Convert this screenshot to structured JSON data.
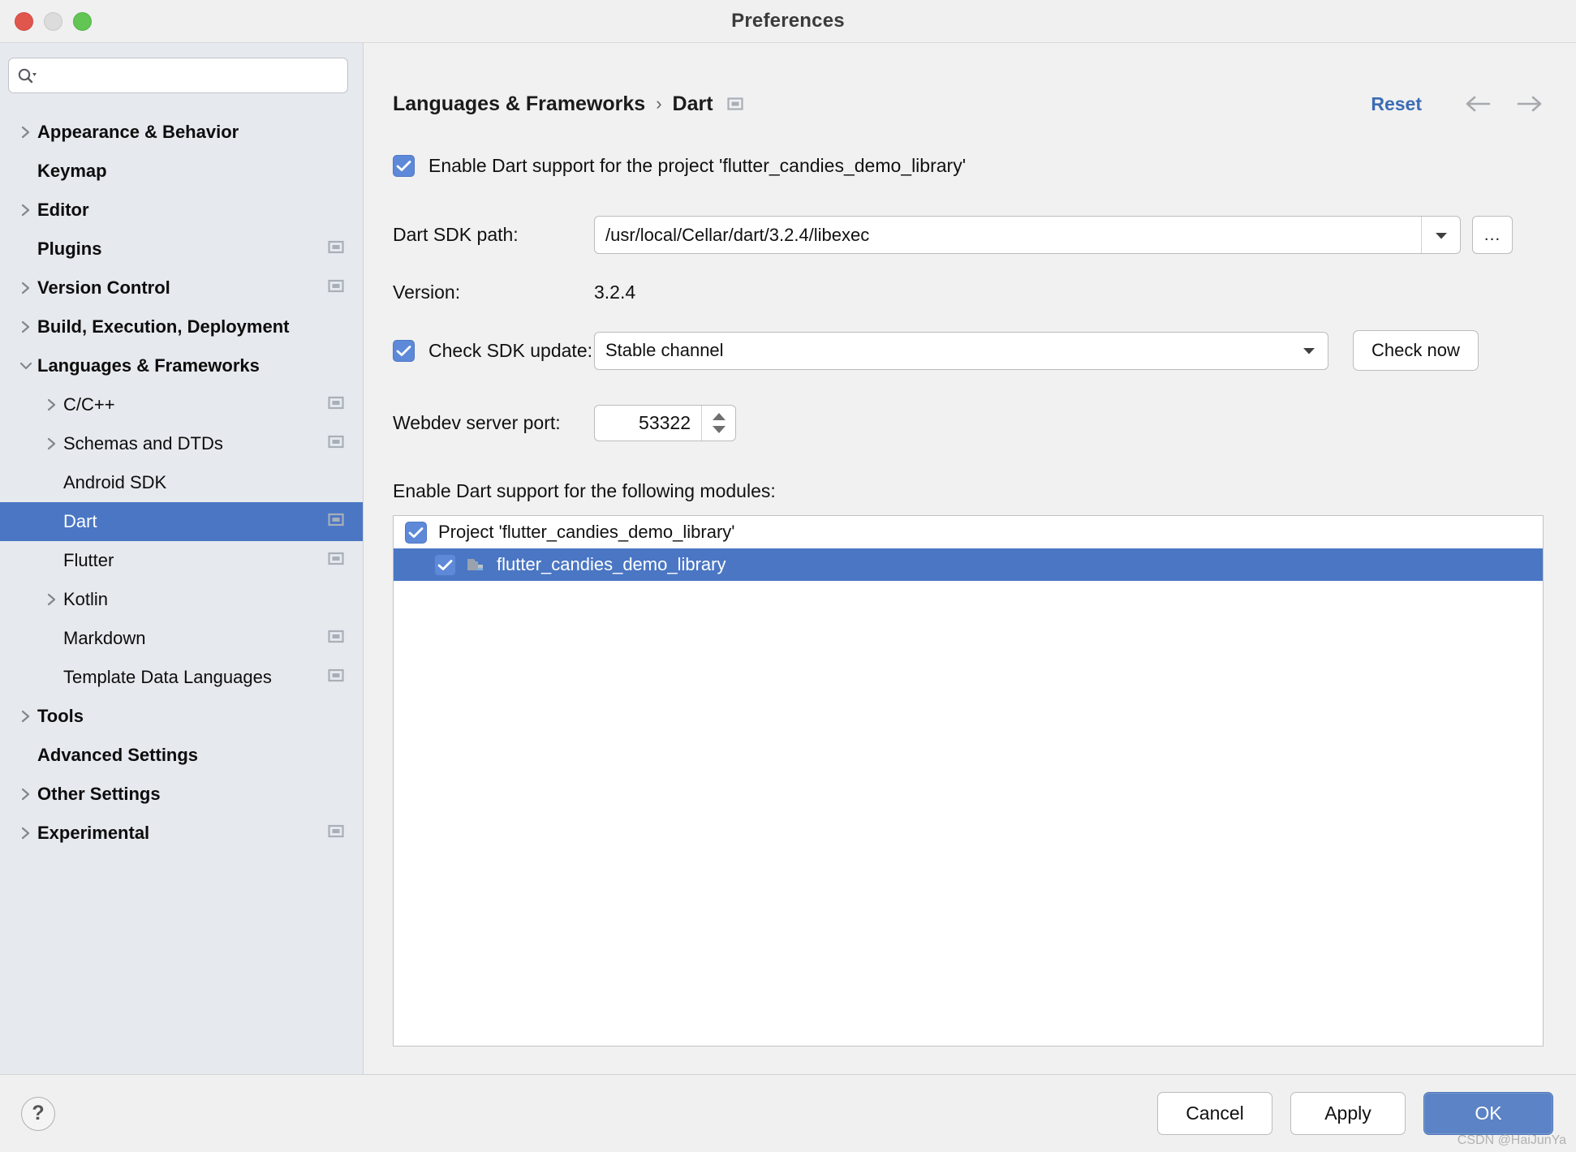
{
  "window": {
    "title": "Preferences",
    "traffic_lights": [
      "close",
      "minimize",
      "maximize"
    ]
  },
  "sidebar": {
    "search": {
      "value": "",
      "placeholder": ""
    },
    "items": [
      {
        "label": "Appearance & Behavior",
        "level": 0,
        "arrow": "right",
        "badge": false,
        "selected": false
      },
      {
        "label": "Keymap",
        "level": 0,
        "arrow": "none",
        "badge": false,
        "selected": false
      },
      {
        "label": "Editor",
        "level": 0,
        "arrow": "right",
        "badge": false,
        "selected": false
      },
      {
        "label": "Plugins",
        "level": 0,
        "arrow": "none",
        "badge": true,
        "selected": false
      },
      {
        "label": "Version Control",
        "level": 0,
        "arrow": "right",
        "badge": true,
        "selected": false
      },
      {
        "label": "Build, Execution, Deployment",
        "level": 0,
        "arrow": "right",
        "badge": false,
        "selected": false
      },
      {
        "label": "Languages & Frameworks",
        "level": 0,
        "arrow": "down",
        "badge": false,
        "selected": false
      },
      {
        "label": "C/C++",
        "level": 1,
        "arrow": "right",
        "badge": true,
        "selected": false
      },
      {
        "label": "Schemas and DTDs",
        "level": 1,
        "arrow": "right",
        "badge": true,
        "selected": false
      },
      {
        "label": "Android SDK",
        "level": 1,
        "arrow": "none",
        "badge": false,
        "selected": false
      },
      {
        "label": "Dart",
        "level": 1,
        "arrow": "none",
        "badge": true,
        "selected": true
      },
      {
        "label": "Flutter",
        "level": 1,
        "arrow": "none",
        "badge": true,
        "selected": false
      },
      {
        "label": "Kotlin",
        "level": 1,
        "arrow": "right",
        "badge": false,
        "selected": false
      },
      {
        "label": "Markdown",
        "level": 1,
        "arrow": "none",
        "badge": true,
        "selected": false
      },
      {
        "label": "Template Data Languages",
        "level": 1,
        "arrow": "none",
        "badge": true,
        "selected": false
      },
      {
        "label": "Tools",
        "level": 0,
        "arrow": "right",
        "badge": false,
        "selected": false
      },
      {
        "label": "Advanced Settings",
        "level": 0,
        "arrow": "none",
        "badge": false,
        "selected": false
      },
      {
        "label": "Other Settings",
        "level": 0,
        "arrow": "right",
        "badge": false,
        "selected": false
      },
      {
        "label": "Experimental",
        "level": 0,
        "arrow": "right",
        "badge": true,
        "selected": false
      }
    ]
  },
  "header": {
    "breadcrumb_parent": "Languages & Frameworks",
    "breadcrumb_separator": "›",
    "breadcrumb_current": "Dart",
    "reset_label": "Reset",
    "back_arrow": "←",
    "forward_arrow": "→"
  },
  "content": {
    "enable_dart_checkbox": {
      "label": "Enable Dart support for the project 'flutter_candies_demo_library'",
      "checked": true
    },
    "sdk_path": {
      "label": "Dart SDK path:",
      "value": "/usr/local/Cellar/dart/3.2.4/libexec",
      "browse_label": "..."
    },
    "version": {
      "label": "Version:",
      "value": "3.2.4"
    },
    "sdk_update": {
      "label": "Check SDK update:",
      "checked": true,
      "channel": "Stable channel",
      "check_now_label": "Check now"
    },
    "webdev_port": {
      "label": "Webdev server port:",
      "value": "53322"
    },
    "modules": {
      "label": "Enable Dart support for the following modules:",
      "rows": [
        {
          "label": "Project 'flutter_candies_demo_library'",
          "checked": true,
          "level": 0,
          "selected": false,
          "icon": false
        },
        {
          "label": "flutter_candies_demo_library",
          "checked": true,
          "level": 1,
          "selected": true,
          "icon": true
        }
      ]
    }
  },
  "footer": {
    "help_label": "?",
    "cancel_label": "Cancel",
    "apply_label": "Apply",
    "ok_label": "OK",
    "watermark": "CSDN @HaiJunYa"
  },
  "colors": {
    "selection_blue": "#4a76c4",
    "accent_link": "#3b6cb4",
    "checkbox_blue": "#5d89d8",
    "primary_button": "#5b83c6",
    "sidebar_bg": "#e6e9ee"
  }
}
